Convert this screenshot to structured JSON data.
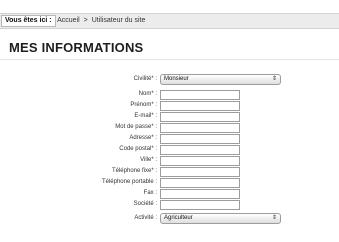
{
  "breadcrumb": {
    "label": "Vous êtes ici :",
    "home": "Accueil",
    "separator": ">",
    "current": "Utilisateur du site"
  },
  "page": {
    "title": "MES INFORMATIONS"
  },
  "form": {
    "civilite": {
      "label": "Civilité* :",
      "value": "Monsieur"
    },
    "nom": {
      "label": "Nom* :",
      "value": ""
    },
    "prenom": {
      "label": "Prénom* :",
      "value": ""
    },
    "email": {
      "label": "E-mail* :",
      "value": ""
    },
    "password": {
      "label": "Mot de passe* :",
      "value": ""
    },
    "adresse": {
      "label": "Adresse* :",
      "value": ""
    },
    "code_postal": {
      "label": "Code postal* :",
      "value": ""
    },
    "ville": {
      "label": "Ville* :",
      "value": ""
    },
    "telephone_fixe": {
      "label": "Téléphone fixe* :",
      "value": ""
    },
    "telephone_portable": {
      "label": "Téléphone portable :",
      "value": ""
    },
    "fax": {
      "label": "Fax :",
      "value": ""
    },
    "societe": {
      "label": "Société :",
      "value": ""
    },
    "activite": {
      "label": "Activité :",
      "value": "Agriculteur"
    }
  },
  "icons": {
    "select_arrow": "up-down-arrows-icon"
  }
}
